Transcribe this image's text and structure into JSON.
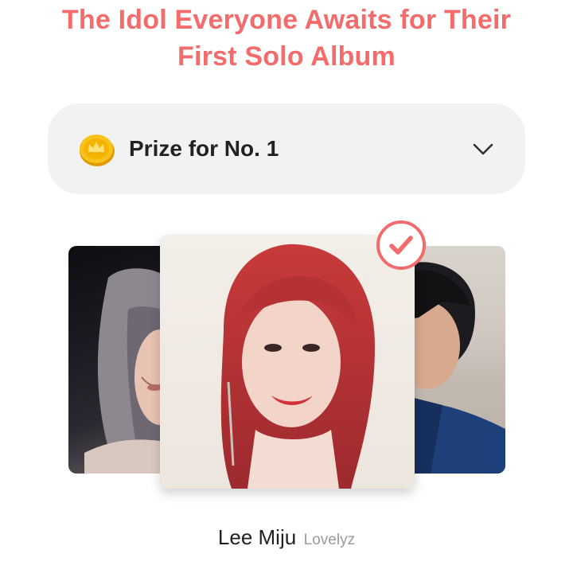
{
  "header": {
    "title": "The Idol Everyone Awaits for Their First Solo Album"
  },
  "prize": {
    "label": "Prize for No. 1",
    "icon": "gold-coin-crown-icon",
    "expand_icon": "chevron-down-icon"
  },
  "carousel": {
    "selected_badge_icon": "checkmark-circle-icon",
    "cards": [
      {
        "position": "left",
        "image": "idol-photo-silver-hair"
      },
      {
        "position": "center",
        "image": "idol-photo-red-hair",
        "selected": true
      },
      {
        "position": "right",
        "image": "idol-photo-dark-hair-blue-jacket"
      }
    ]
  },
  "selected": {
    "name": "Lee Miju",
    "group": "Lovelyz"
  },
  "colors": {
    "accent": "#f36b6b",
    "prize_bar_bg": "#f2f2f2",
    "coin": "#f5b400",
    "text_primary": "#222222",
    "text_secondary": "#9a9a9a"
  }
}
